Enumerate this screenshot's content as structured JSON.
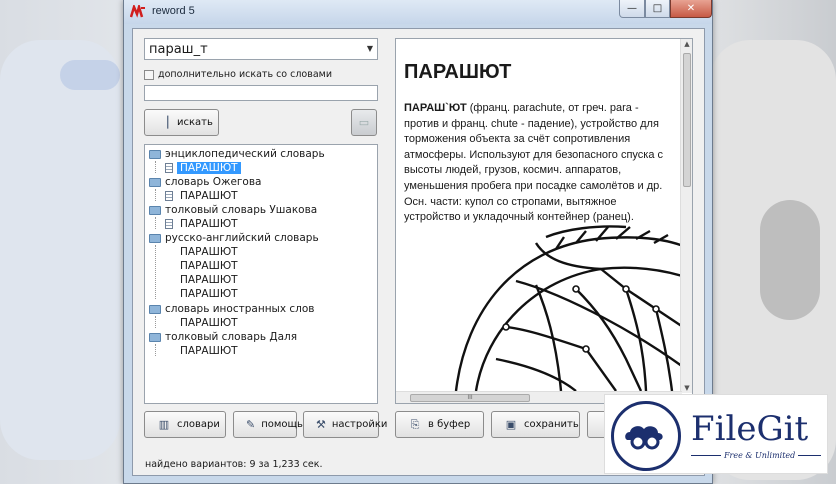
{
  "window": {
    "title": "reword 5",
    "controls": {
      "minimize": "—",
      "maximize": "□",
      "close": "✕"
    }
  },
  "search": {
    "query": "параш_т",
    "also_search_label": "дополнительно искать со словами",
    "extra_words_value": "",
    "search_button": "искать"
  },
  "tree": [
    {
      "dictionary": "энциклопедический словарь",
      "entries": [
        {
          "word": "ПАРАШЮТ",
          "selected": true
        }
      ]
    },
    {
      "dictionary": "словарь Ожегова",
      "entries": [
        {
          "word": "ПАРАШЮТ"
        }
      ]
    },
    {
      "dictionary": "толковый словарь Ушакова",
      "entries": [
        {
          "word": "ПАРАШЮТ"
        }
      ]
    },
    {
      "dictionary": "русско-английский словарь",
      "entries": [
        {
          "word": "ПАРАШЮТ"
        },
        {
          "word": "ПАРАШЮТ"
        },
        {
          "word": "ПАРАШЮТ"
        },
        {
          "word": "ПАРАШЮТ"
        }
      ]
    },
    {
      "dictionary": "словарь иностранных слов",
      "entries": [
        {
          "word": "ПАРАШЮТ"
        }
      ]
    },
    {
      "dictionary": "толковый словарь Даля",
      "entries": [
        {
          "word": "ПАРАШЮТ"
        }
      ]
    }
  ],
  "left_buttons": {
    "dictionaries": "словари",
    "help": "помощь",
    "settings": "настройки"
  },
  "status": "найдено вариантов: 9 за 1,233 сек.",
  "article": {
    "title": "ПАРАШЮТ",
    "headword": "ПАРАШ`ЮТ",
    "body": " (франц. parachute, от греч. para - против и франц. chute - падение), устройство для торможения объекта за счёт сопротивления атмосферы. Используют для безопасного спуска с высоты людей, грузов, космич. аппаратов, уменьшения пробега при посадке самолётов и др. Осн. части: купол со стропами, вытяжное устройство и укладочный контейнер (ранец).",
    "hscroll_grip": "III"
  },
  "right_buttons": {
    "copy": "в буфер",
    "save": "сохранить"
  },
  "watermark": {
    "title": "FileGit",
    "subtitle": "Free & Unlimited"
  },
  "colors": {
    "selection": "#3399ff",
    "brand": "#1c2f6e",
    "close": "#c75a45"
  }
}
